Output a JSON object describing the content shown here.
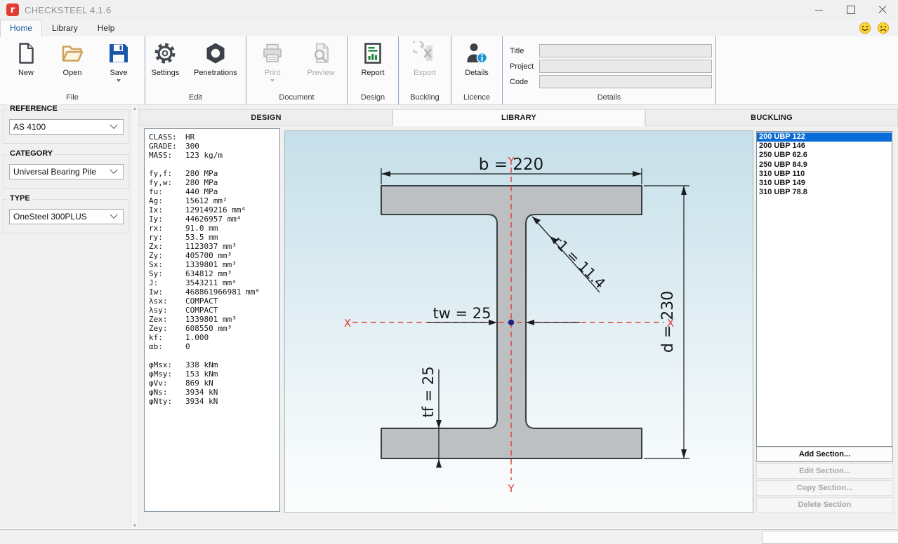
{
  "window": {
    "title": "CHECKSTEEL 4.1.6",
    "icon_letter": "r"
  },
  "menubar": {
    "tabs": [
      "Home",
      "Library",
      "Help"
    ],
    "active": "Home"
  },
  "ribbon": {
    "groups": [
      {
        "label": "File",
        "buttons": [
          {
            "label": "New",
            "icon": "new-document-icon",
            "enabled": true
          },
          {
            "label": "Open",
            "icon": "open-folder-icon",
            "enabled": true
          },
          {
            "label": "Save",
            "icon": "save-floppy-icon",
            "enabled": true,
            "has_dropdown": true
          }
        ]
      },
      {
        "label": "Edit",
        "buttons": [
          {
            "label": "Settings",
            "icon": "settings-gear-icon",
            "enabled": true
          },
          {
            "label": "Penetrations",
            "icon": "penetrations-nut-icon",
            "enabled": true
          }
        ]
      },
      {
        "label": "Document",
        "buttons": [
          {
            "label": "Print",
            "icon": "printer-icon",
            "enabled": false,
            "has_dropdown": true
          },
          {
            "label": "Preview",
            "icon": "print-preview-icon",
            "enabled": false
          }
        ]
      },
      {
        "label": "Design",
        "buttons": [
          {
            "label": "Report",
            "icon": "report-chart-icon",
            "enabled": true
          }
        ]
      },
      {
        "label": "Buckling",
        "buttons": [
          {
            "label": "Export",
            "icon": "export-excel-icon",
            "enabled": false
          }
        ]
      },
      {
        "label": "Licence",
        "buttons": [
          {
            "label": "Details",
            "icon": "licence-details-icon",
            "enabled": true
          }
        ]
      },
      {
        "label": "Details",
        "fields": [
          {
            "label": "Title",
            "value": ""
          },
          {
            "label": "Project",
            "value": ""
          },
          {
            "label": "Code",
            "value": ""
          }
        ]
      }
    ]
  },
  "sidebar": {
    "groups": [
      {
        "label": "REFERENCE",
        "value": "AS 4100"
      },
      {
        "label": "CATEGORY",
        "value": "Universal Bearing Pile"
      },
      {
        "label": "TYPE",
        "value": "OneSteel 300PLUS"
      }
    ]
  },
  "view_tabs": {
    "items": [
      "DESIGN",
      "LIBRARY",
      "BUCKLING"
    ],
    "active": "LIBRARY"
  },
  "properties": {
    "lines": [
      {
        "l": "CLASS:",
        "v": "HR"
      },
      {
        "l": "GRADE:",
        "v": "300"
      },
      {
        "l": "MASS:",
        "v": "123 kg/m"
      },
      {
        "l": "",
        "v": ""
      },
      {
        "l": "fy,f:",
        "v": "280 MPa"
      },
      {
        "l": "fy,w:",
        "v": "280 MPa"
      },
      {
        "l": "fu:",
        "v": "440 MPa"
      },
      {
        "l": "Ag:",
        "v": "15612 mm²"
      },
      {
        "l": "Ix:",
        "v": "129149216 mm⁴"
      },
      {
        "l": "Iy:",
        "v": "44626957 mm⁴"
      },
      {
        "l": "rx:",
        "v": "91.0 mm"
      },
      {
        "l": "ry:",
        "v": "53.5 mm"
      },
      {
        "l": "Zx:",
        "v": "1123037 mm³"
      },
      {
        "l": "Zy:",
        "v": "405700 mm³"
      },
      {
        "l": "Sx:",
        "v": "1339801 mm³"
      },
      {
        "l": "Sy:",
        "v": "634812 mm³"
      },
      {
        "l": "J:",
        "v": "3543211 mm⁴"
      },
      {
        "l": "Iw:",
        "v": "468861966981 mm⁶"
      },
      {
        "l": "λsx:",
        "v": "COMPACT"
      },
      {
        "l": "λsy:",
        "v": "COMPACT"
      },
      {
        "l": "Zex:",
        "v": "1339801 mm³"
      },
      {
        "l": "Zey:",
        "v": "608550 mm³"
      },
      {
        "l": "kf:",
        "v": "1.000"
      },
      {
        "l": "αb:",
        "v": "0"
      },
      {
        "l": "",
        "v": ""
      },
      {
        "l": "φMsx:",
        "v": "338 kNm"
      },
      {
        "l": "φMsy:",
        "v": "153 kNm"
      },
      {
        "l": "φVv:",
        "v": "869 kN"
      },
      {
        "l": "φNs:",
        "v": "3934 kN"
      },
      {
        "l": "φNty:",
        "v": "3934 kN"
      }
    ]
  },
  "diagram": {
    "labels": {
      "width": "b = 220",
      "fillet": "r1 = 11.4",
      "web": "tw = 25",
      "depth": "d = 230",
      "flange": "tf = 25",
      "axis_x_left": "X",
      "axis_x_right": "X",
      "axis_y_top": "Y",
      "axis_y_bottom": "Y"
    },
    "colors": {
      "steel_fill": "#bcc0c2",
      "outline": "#383d42",
      "axis_red": "#e0413c",
      "centroid_blue": "#1a2680"
    }
  },
  "library": {
    "sections": [
      "200 UBP 122",
      "200 UBP 146",
      "250 UBP 62.6",
      "250 UBP 84.9",
      "310 UBP 110",
      "310 UBP 149",
      "310 UBP 78.8"
    ],
    "selected_index": 0,
    "buttons": [
      {
        "label": "Add Section...",
        "enabled": true
      },
      {
        "label": "Edit Section...",
        "enabled": false
      },
      {
        "label": "Copy Section...",
        "enabled": false
      },
      {
        "label": "Delete Section",
        "enabled": false
      }
    ]
  }
}
